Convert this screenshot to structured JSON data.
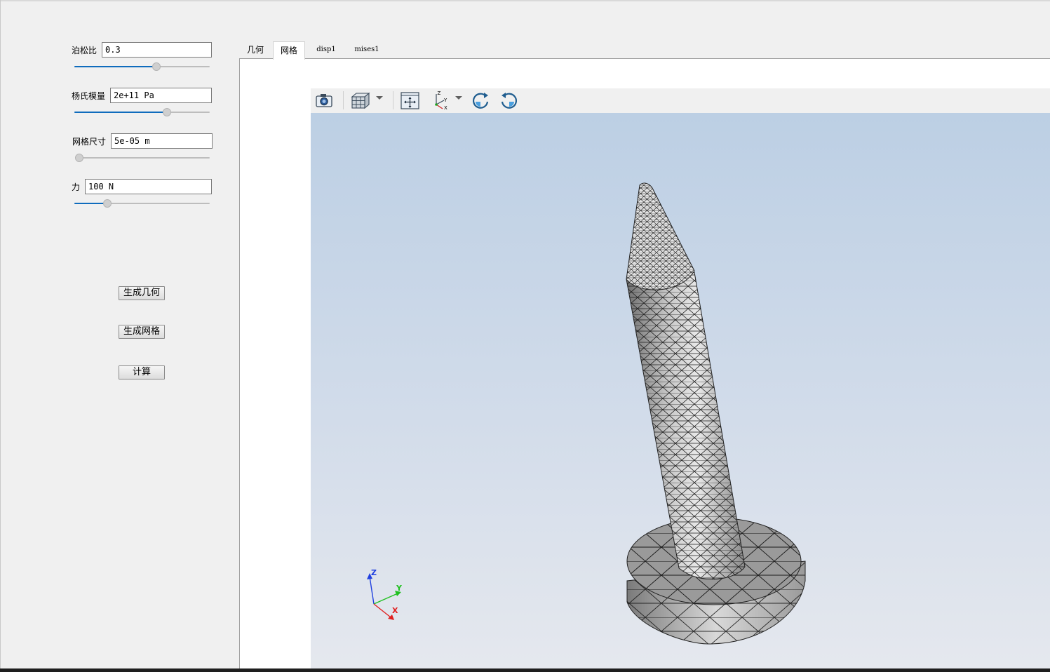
{
  "params": {
    "poisson": {
      "label": "泊松比",
      "value": "0.3",
      "slider_fraction": 0.58
    },
    "young": {
      "label": "杨氏模量",
      "value": "2e+11 Pa",
      "slider_fraction": 0.66
    },
    "mesh_size": {
      "label": "网格尺寸",
      "value": "5e-05 m",
      "slider_fraction": 0.0
    },
    "force": {
      "label": "力",
      "value": "100 N",
      "slider_fraction": 0.22
    }
  },
  "buttons": {
    "gen_geometry": "生成几何",
    "gen_mesh": "生成网格",
    "compute": "计算"
  },
  "tabs": [
    {
      "label": "几何",
      "active": false
    },
    {
      "label": "网格",
      "active": true
    },
    {
      "label": "disp1",
      "active": false
    },
    {
      "label": "mises1",
      "active": false
    }
  ],
  "toolbar": {
    "icons": [
      "camera-icon",
      "cube-view-icon",
      "fit-view-icon",
      "axes-orientation-icon",
      "rotate-clockwise-icon",
      "rotate-counterclockwise-icon"
    ]
  },
  "axes_triad": {
    "x": "X",
    "y": "Y",
    "z": "Z"
  },
  "colors": {
    "slider_accent": "#0f6cbd",
    "viewport_top": "#bccfe4",
    "viewport_bottom": "#e5e8ee",
    "mesh_light": "#e6e6e6",
    "mesh_dark": "#7a7a7a",
    "axis_x": "#e02020",
    "axis_y": "#20c020",
    "axis_z": "#2040e0"
  }
}
